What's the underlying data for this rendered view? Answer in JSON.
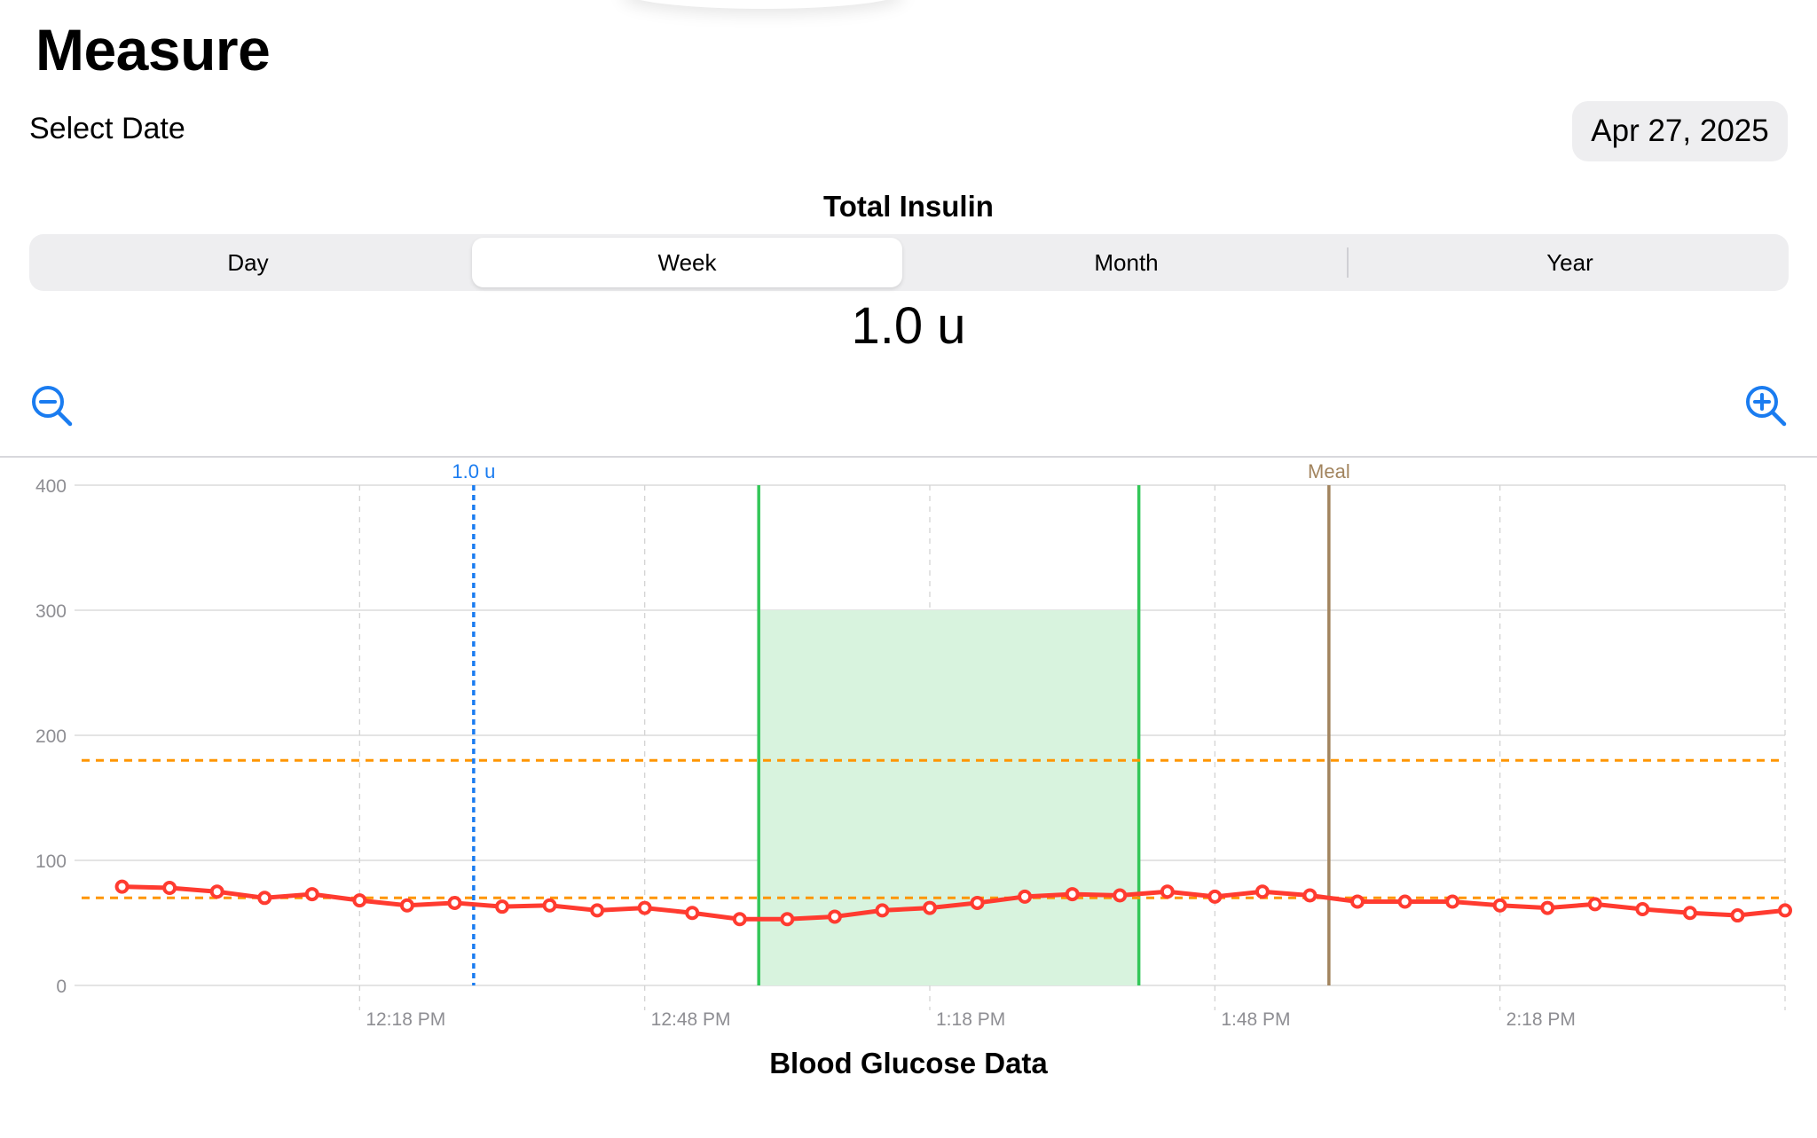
{
  "header": {
    "title": "Measure"
  },
  "date_picker": {
    "label": "Select Date",
    "value": "Apr 27, 2025"
  },
  "insulin": {
    "title": "Total Insulin",
    "segments": [
      {
        "label": "Day",
        "selected": false
      },
      {
        "label": "Week",
        "selected": true
      },
      {
        "label": "Month",
        "selected": false
      },
      {
        "label": "Year",
        "selected": false
      }
    ],
    "total": "1.0 u"
  },
  "toolbar": {
    "zoom_out_icon": "zoom-out-icon",
    "zoom_in_icon": "zoom-in-icon"
  },
  "colors": {
    "accent": "#1a7cf0",
    "glucose_line": "#ff3b30",
    "threshold": "#ff9500",
    "exercise": "#34c759",
    "exercise_fill": "#d8f3de",
    "meal": "#a2845e"
  },
  "chart_data": {
    "type": "line",
    "title": "Blood Glucose Data",
    "ylim": [
      0,
      400
    ],
    "yticks": [
      "0",
      "100",
      "200",
      "300",
      "400"
    ],
    "xticks": [
      "12:18 PM",
      "12:48 PM",
      "1:18 PM",
      "1:48 PM",
      "2:18 PM"
    ],
    "x_range_minutes": [
      -30,
      150
    ],
    "grid": true,
    "series": [
      {
        "type": "line",
        "x_minutes": [
          -25,
          -20,
          -15,
          -10,
          -5,
          0,
          5,
          10,
          15,
          20,
          25,
          30,
          35,
          40,
          45,
          50,
          55,
          60,
          65,
          70,
          75,
          80,
          85,
          90,
          95,
          100,
          105,
          110,
          115,
          120,
          125,
          130,
          135,
          140,
          145,
          150
        ],
        "values": [
          79,
          78,
          75,
          70,
          73,
          68,
          64,
          66,
          63,
          64,
          60,
          62,
          58,
          53,
          53,
          55,
          60,
          62,
          66,
          71,
          73,
          72,
          75,
          71,
          75,
          72,
          67,
          67,
          67,
          64,
          62,
          65,
          61,
          58,
          56,
          60
        ]
      }
    ],
    "thresholds": [
      180,
      70
    ],
    "annotations": {
      "insulin_dose": {
        "label": "1.0 u",
        "x_minutes": 12
      },
      "meal": {
        "label": "Meal",
        "x_minutes": 102
      },
      "exercise_range": {
        "x_start_minutes": 42,
        "x_end_minutes": 82,
        "y_top": 300
      }
    }
  }
}
